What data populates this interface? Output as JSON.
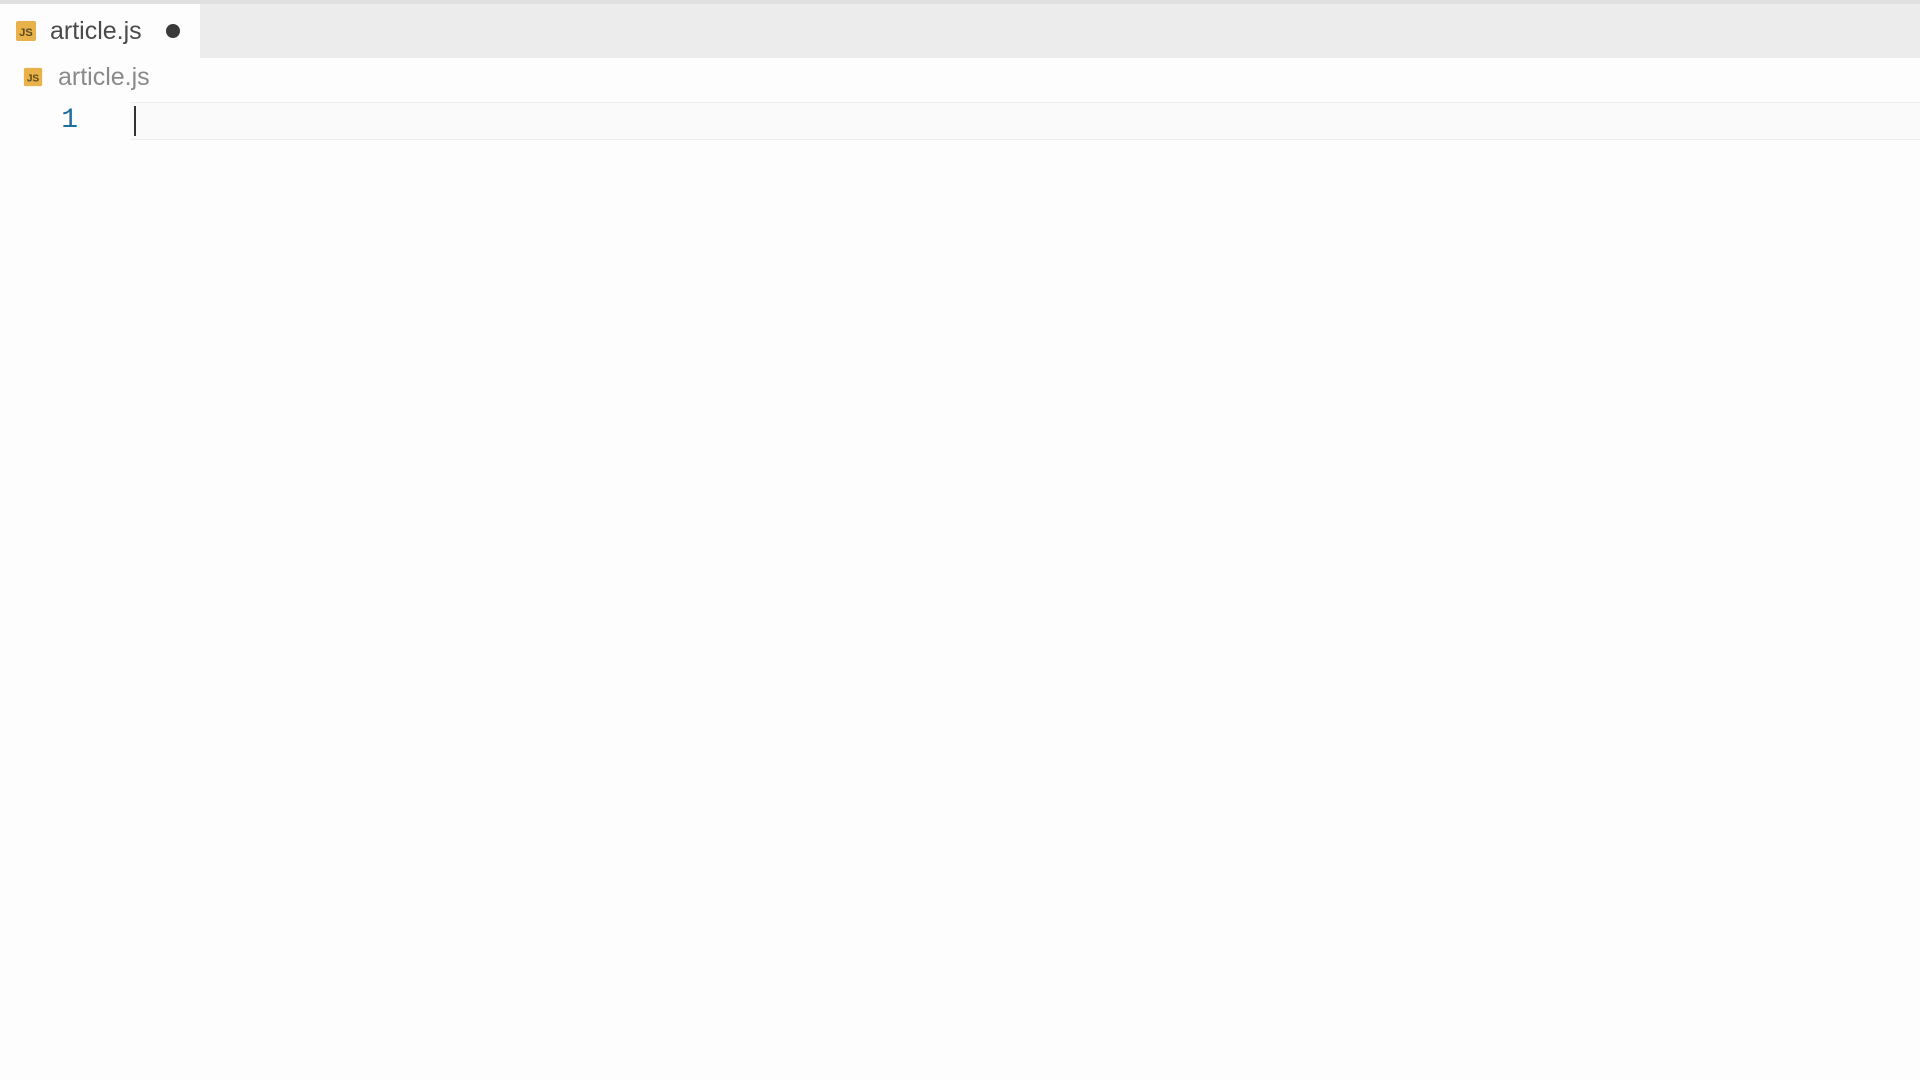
{
  "tab": {
    "filename": "article.js",
    "dirty": true
  },
  "breadcrumb": {
    "filename": "article.js"
  },
  "editor": {
    "lines": [
      {
        "number": "1",
        "content": ""
      }
    ]
  },
  "colors": {
    "tabBar": "#ececec",
    "activeTab": "#fdfdfd",
    "lineNumber": "#1c6ea4",
    "jsIcon": "#e8b14a"
  }
}
